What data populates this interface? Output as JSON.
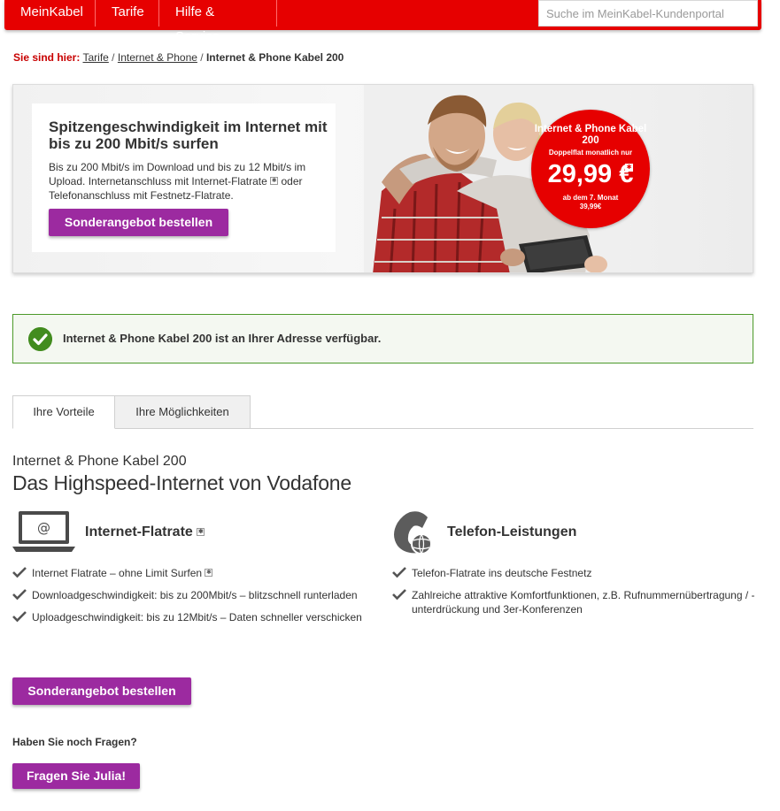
{
  "nav": {
    "items": [
      {
        "label": "MeinKabel"
      },
      {
        "label": "Tarife"
      },
      {
        "label": "Hilfe & Service"
      }
    ],
    "search_placeholder": "Suche im MeinKabel-Kundenportal"
  },
  "breadcrumb": {
    "prefix": "Sie sind hier:",
    "links": [
      "Tarife",
      "Internet & Phone"
    ],
    "separator": "/",
    "current": "Internet & Phone Kabel 200"
  },
  "hero": {
    "title": "Spitzengeschwindigkeit im Internet mit bis zu 200 Mbit/s surfen",
    "description": "Bis zu 200 Mbit/s im Download und bis zu 12 Mbit/s im Upload. Internetanschluss mit Internet-Flatrate",
    "description_end": "oder Telefonanschluss mit Festnetz-Flatrate.",
    "button_label": "Sonderangebot bestellen",
    "badge": {
      "name": "Internet & Phone Kabel 200",
      "subline": "Doppelflat monatlich nur",
      "price": "29,99 €",
      "after_line": "ab dem 7. Monat",
      "after_price": "39,99€"
    }
  },
  "notice": {
    "text": "Internet & Phone Kabel 200 ist an Ihrer Adresse verfügbar."
  },
  "tabs": [
    {
      "label": "Ihre Vorteile",
      "active": true
    },
    {
      "label": "Ihre Möglichkeiten",
      "active": false
    }
  ],
  "product": {
    "title": "Internet & Phone Kabel 200",
    "subtitle": "Das Highspeed-Internet von Vodafone"
  },
  "features": {
    "internet": {
      "title": "Internet-Flatrate",
      "icon": "laptop-at-icon",
      "items": [
        "Internet Flatrate – ohne Limit Surfen",
        "Downloadgeschwindigkeit: bis zu 200Mbit/s – blitzschnell runterladen",
        "Uploadgeschwindigkeit: bis zu 12Mbit/s – Daten schneller verschicken"
      ]
    },
    "phone": {
      "title": "Telefon-Leistungen",
      "icon": "phone-globe-icon",
      "items": [
        "Telefon-Flatrate ins deutsche Festnetz",
        "Zahlreiche attraktive Komfortfunktionen, z.B. Rufnummernübertragung / -unterdrückung und 3er-Konferenzen"
      ]
    }
  },
  "order_button": "Sonderangebot bestellen",
  "faq": {
    "label": "Haben Sie noch Fragen?",
    "button": "Fragen Sie Julia!"
  },
  "colors": {
    "brand_red": "#e60000",
    "purple_button": "#9c2aa0",
    "success_green": "#428c1f"
  }
}
